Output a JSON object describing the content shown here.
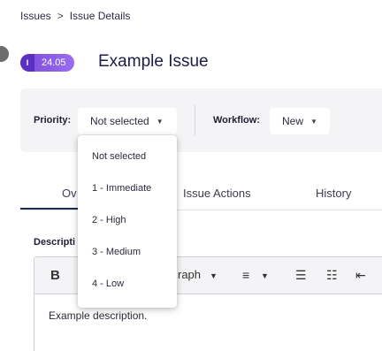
{
  "breadcrumb": {
    "root": "Issues",
    "separator": ">",
    "current": "Issue Details"
  },
  "issue": {
    "badge_icon": "I",
    "badge_version": "24.05",
    "title": "Example Issue"
  },
  "filters": {
    "priority_label": "Priority:",
    "priority_value": "Not selected",
    "workflow_label": "Workflow:",
    "workflow_value": "New",
    "caret": "▼"
  },
  "tabs": {
    "overview": "Ov",
    "issue_actions": "Issue Actions",
    "history": "History"
  },
  "description": {
    "label": "Descripti",
    "body": "Example description."
  },
  "editor_toolbar": {
    "bold": "B",
    "paragraph": "raph",
    "caret": "▼",
    "align": "≡",
    "ordered_list": "☰",
    "bullet_list": "☷",
    "outdent": "⇤"
  },
  "priority_options": [
    "Not selected",
    "1 - Immediate",
    "2 - High",
    "3 - Medium",
    "4 - Low"
  ],
  "colors": {
    "accent_purple": "#7a4cd8",
    "title_navy": "#1c1c48",
    "tab_underline": "#1c2c5a"
  }
}
